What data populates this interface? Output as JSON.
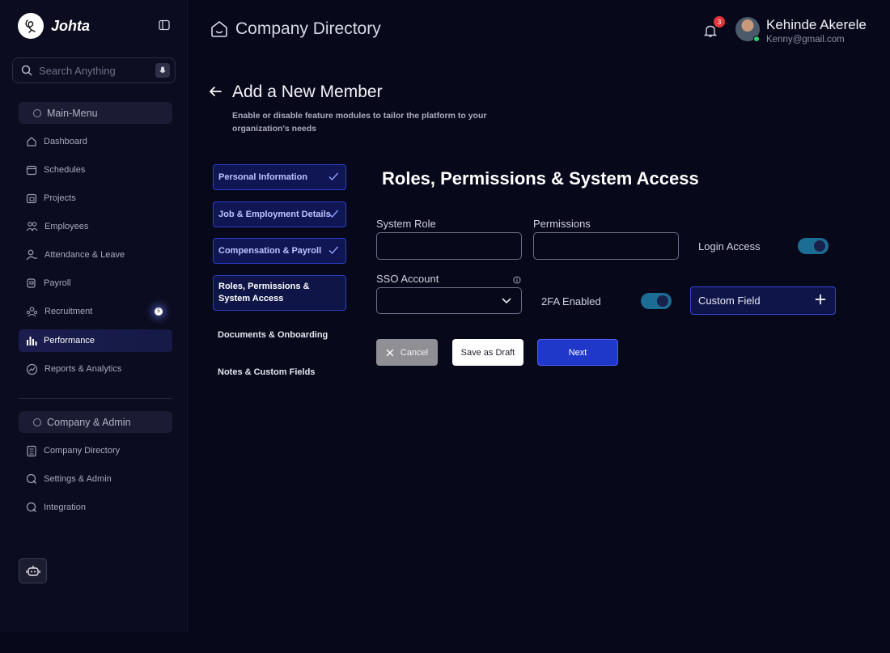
{
  "brand": {
    "name": "Johta"
  },
  "search": {
    "placeholder": "Search Anything"
  },
  "sidebar": {
    "main_menu_label": "Main-Menu",
    "items": [
      {
        "label": "Dashboard",
        "icon": "home-icon"
      },
      {
        "label": "Schedules",
        "icon": "calendar-icon"
      },
      {
        "label": "Projects",
        "icon": "folder-icon"
      },
      {
        "label": "Employees",
        "icon": "users-icon"
      },
      {
        "label": "Attendance & Leave",
        "icon": "user-check-icon"
      },
      {
        "label": "Payroll",
        "icon": "payroll-icon"
      },
      {
        "label": "Recruitment",
        "icon": "recruitment-icon",
        "badge": "5"
      },
      {
        "label": "Performance",
        "icon": "chart-bars-icon",
        "active": true
      },
      {
        "label": "Reports & Analytics",
        "icon": "report-icon"
      }
    ],
    "company_admin_label": "Company & Admin",
    "admin_items": [
      {
        "label": "Company Directory",
        "icon": "directory-icon"
      },
      {
        "label": "Settings & Admin",
        "icon": "settings-icon"
      },
      {
        "label": "Integration",
        "icon": "integration-icon"
      }
    ]
  },
  "header": {
    "title": "Company Directory",
    "notification_count": "3",
    "user_name": "Kehinde Akerele",
    "user_email": "Kenny@gmail.com"
  },
  "page": {
    "title": "Add a New Member",
    "description": "Enable or disable feature modules to tailor the platform to your organization's needs"
  },
  "steps": [
    {
      "label": "Personal Information",
      "state": "completed"
    },
    {
      "label": "Job & Employment Details",
      "state": "completed"
    },
    {
      "label": "Compensation & Payroll",
      "state": "completed"
    },
    {
      "label": "Roles, Permissions & System Access",
      "state": "current"
    },
    {
      "label": "Documents & Onboarding",
      "state": "pending"
    },
    {
      "label": "Notes & Custom Fields",
      "state": "pending"
    }
  ],
  "form": {
    "title": "Roles, Permissions & System Access",
    "system_role_label": "System Role",
    "system_role_value": "",
    "permissions_label": "Permissions",
    "permissions_value": "",
    "login_access_label": "Login Access",
    "login_access_enabled": true,
    "sso_account_label": "SSO Account",
    "sso_account_value": "",
    "twofa_label": "2FA Enabled",
    "twofa_enabled": true,
    "custom_field_label": "Custom Field"
  },
  "actions": {
    "cancel": "Cancel",
    "save_draft": "Save as Draft",
    "next": "Next"
  },
  "colors": {
    "background": "#07081a",
    "sidebar": "#0b0c1f",
    "accent": "#2038c9",
    "toggle_on": "#1c6d93",
    "notification": "#e5343b"
  }
}
